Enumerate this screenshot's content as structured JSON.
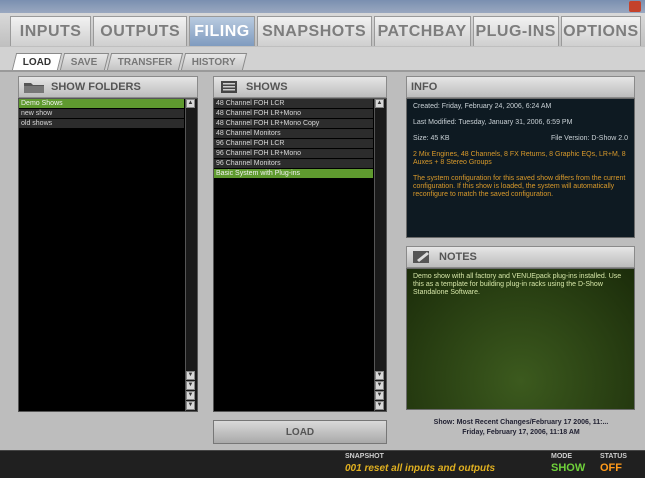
{
  "window": {
    "title": ""
  },
  "main_tabs": [
    {
      "label": "INPUTS",
      "active": false
    },
    {
      "label": "OUTPUTS",
      "active": false
    },
    {
      "label": "FILING",
      "active": true
    },
    {
      "label": "SNAPSHOTS",
      "active": false
    },
    {
      "label": "PATCHBAY",
      "active": false
    },
    {
      "label": "PLUG-INS",
      "active": false
    },
    {
      "label": "OPTIONS",
      "active": false
    }
  ],
  "sub_tabs": [
    {
      "label": "LOAD",
      "active": true
    },
    {
      "label": "SAVE",
      "active": false
    },
    {
      "label": "TRANSFER",
      "active": false
    },
    {
      "label": "HISTORY",
      "active": false
    }
  ],
  "show_folders": {
    "title": "SHOW FOLDERS",
    "icon": "folder-icon",
    "items": [
      {
        "label": "Demo Shows",
        "selected": true
      },
      {
        "label": "new show",
        "selected": false
      },
      {
        "label": "old shows",
        "selected": false
      }
    ]
  },
  "shows": {
    "title": "SHOWS",
    "icon": "document-list-icon",
    "items": [
      {
        "label": "48 Channel FOH LCR",
        "selected": false
      },
      {
        "label": "48 Channel FOH LR+Mono",
        "selected": false
      },
      {
        "label": "48 Channel FOH LR+Mono Copy",
        "selected": false
      },
      {
        "label": "48 Channel Monitors",
        "selected": false
      },
      {
        "label": "96 Channel FOH LCR",
        "selected": false
      },
      {
        "label": "96 Channel FOH LR+Mono",
        "selected": false
      },
      {
        "label": "96 Channel Monitors",
        "selected": false
      },
      {
        "label": "Basic System with Plug-ins",
        "selected": true
      }
    ]
  },
  "info": {
    "title": "INFO",
    "created": "Created: Friday, February 24, 2006, 6:24 AM",
    "modified": "Last Modified: Tuesday, January 31, 2006, 6:59 PM",
    "size": "Size: 45 KB",
    "file_version": "File Version: D-Show 2.0",
    "config": "2 Mix Engines, 48 Channels, 8 FX Returns, 8 Graphic EQs, LR+M, 8 Auxes + 8 Stereo Groups",
    "warning": "The system configuration for this saved show differs from the current configuration. If this show is loaded, the system will automatically reconfigure to match the saved configuration."
  },
  "notes": {
    "title": "NOTES",
    "icon": "notepad-icon",
    "text": "Demo show with all factory and VENUEpack plug-ins installed. Use this as a template for building plug-in racks using the D-Show Standalone Software."
  },
  "load_button": {
    "label": "LOAD"
  },
  "show_status": {
    "line1": "Show: Most Recent Changes/February 17 2006, 11:...",
    "line2": "Friday, February 17, 2006, 11:18 AM"
  },
  "bottom_bar": {
    "snapshot_label": "SNAPSHOT",
    "snapshot_value": "001 reset all inputs and outputs",
    "mode_label": "MODE",
    "mode_value": "SHOW",
    "status_label": "STATUS",
    "status_value": "OFF"
  },
  "colors": {
    "active_tab": "#7f9bbf",
    "selected_row": "#5f9a2f",
    "info_orange": "#d99a2b",
    "mode_green": "#6fd13a",
    "status_orange": "#ff9a1a",
    "snapshot_yellow": "#e0b020"
  }
}
